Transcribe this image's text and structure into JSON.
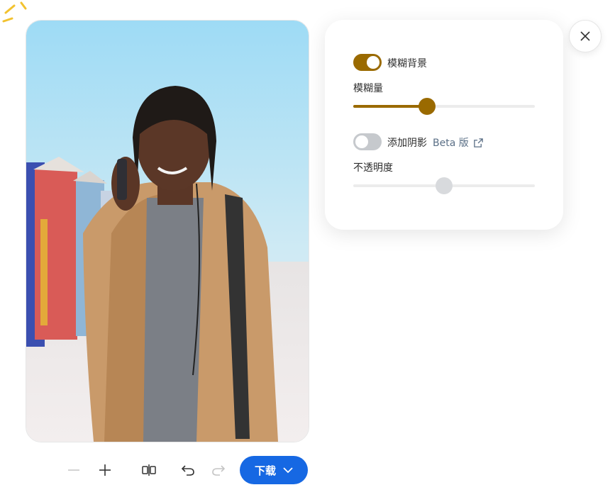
{
  "panel": {
    "blur_toggle": {
      "label": "模糊背景",
      "on": true
    },
    "blur_amount": {
      "label": "模糊量",
      "value": 0.405
    },
    "shadow_toggle": {
      "label": "添加阴影",
      "on": false,
      "beta": "Beta 版"
    },
    "opacity": {
      "label": "不透明度",
      "value": 0.5
    }
  },
  "toolbar": {
    "zoom_out": "zoom-out",
    "zoom_in": "zoom-in",
    "compare": "compare",
    "undo": "undo",
    "redo": "redo",
    "download_label": "下载"
  },
  "colors": {
    "accent": "#9a6a00",
    "primary": "#1668e3",
    "toggle_off": "#c6c9cd",
    "thumb_off": "#d8dadd"
  }
}
